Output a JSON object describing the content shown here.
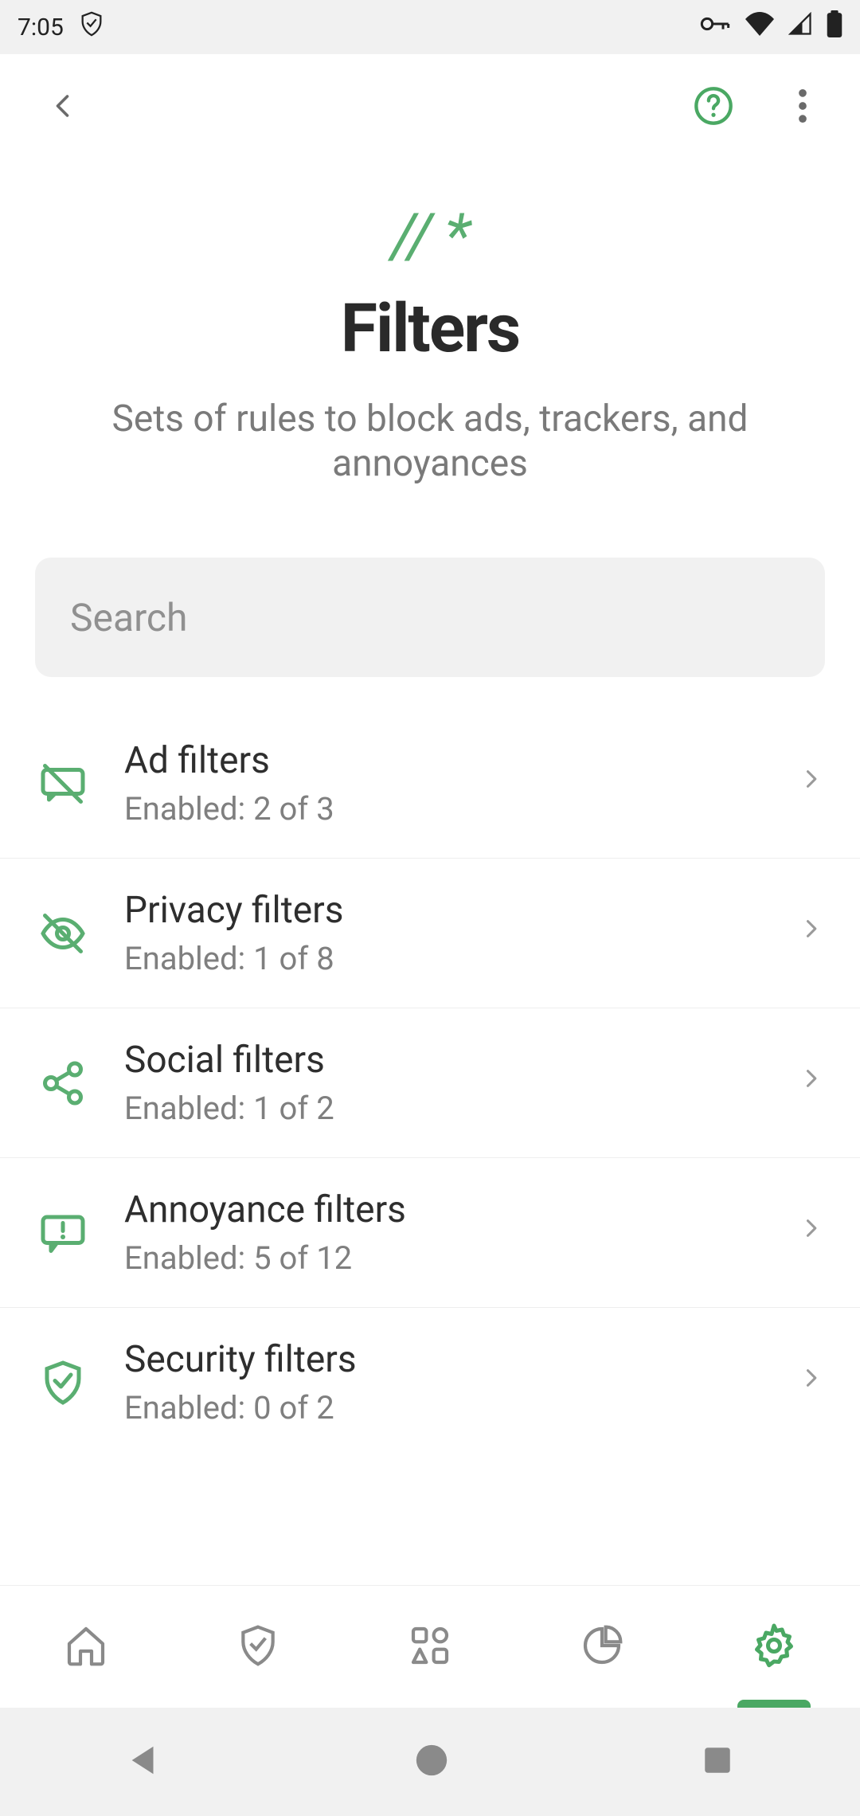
{
  "statusbar": {
    "time": "7:05"
  },
  "header": {
    "logo_text": "// *",
    "title": "Filters",
    "subtitle": "Sets of rules to block ads, trackers, and annoyances"
  },
  "search": {
    "placeholder": "Search",
    "value": ""
  },
  "filters": [
    {
      "title": "Ad filters",
      "subtitle": "Enabled: 2 of 3",
      "icon": "chat-slash"
    },
    {
      "title": "Privacy filters",
      "subtitle": "Enabled: 1 of 8",
      "icon": "eye-slash"
    },
    {
      "title": "Social filters",
      "subtitle": "Enabled: 1 of 2",
      "icon": "share-nodes"
    },
    {
      "title": "Annoyance filters",
      "subtitle": "Enabled: 5 of 12",
      "icon": "chat-alert"
    },
    {
      "title": "Security filters",
      "subtitle": "Enabled: 0 of 2",
      "icon": "shield-check"
    }
  ],
  "bottomnav": {
    "items": [
      "home",
      "protection",
      "apps",
      "stats",
      "settings"
    ],
    "active_index": 4
  }
}
